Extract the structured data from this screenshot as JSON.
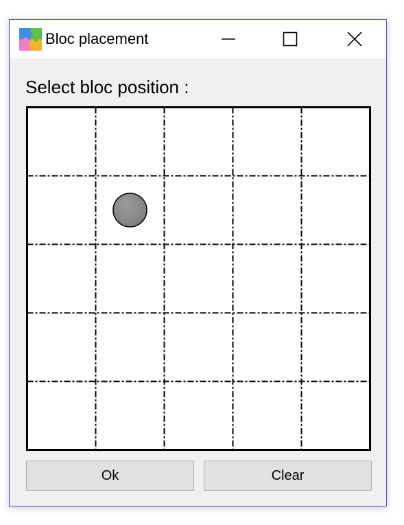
{
  "window": {
    "title": "Bloc placement",
    "icon": "puzzle-icon",
    "controls": {
      "minimize": "minimize-icon",
      "maximize": "maximize-icon",
      "close": "close-icon"
    }
  },
  "dialog": {
    "prompt": "Select bloc position :",
    "grid": {
      "rows": 5,
      "columns": 5,
      "selected": {
        "row": 2,
        "column": 2
      },
      "marker_color": "#808080",
      "line_style": "dash-dot"
    },
    "buttons": {
      "ok_label": "Ok",
      "clear_label": "Clear"
    }
  },
  "colors": {
    "window_border": "#4a59c8",
    "dialog_background": "#f0f0f0",
    "button_background": "#e1e1e1"
  }
}
